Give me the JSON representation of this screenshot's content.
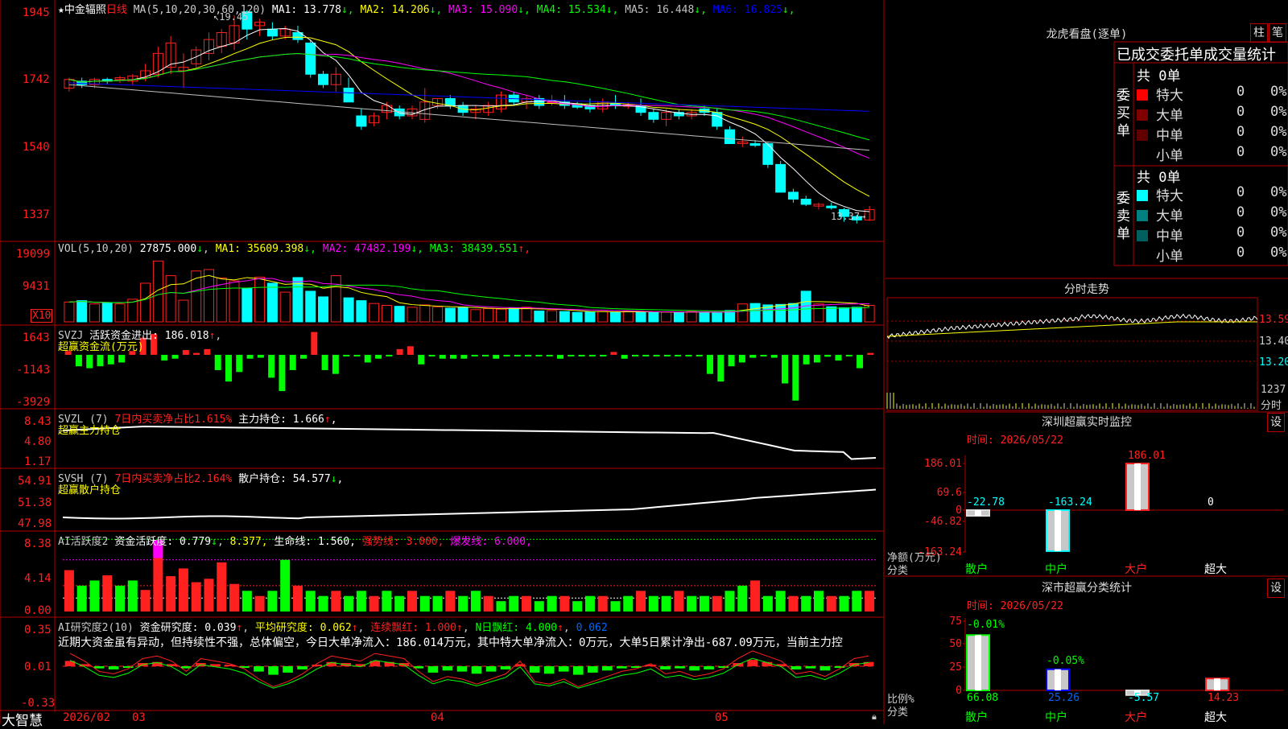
{
  "app": {
    "name": "大智慧"
  },
  "stock": {
    "star": "★",
    "name": "中金辐照",
    "period": "日线"
  },
  "colors": {
    "up": "#ff2020",
    "down": "#00ffff",
    "ma1": "#ffffff",
    "ma2": "#ffff00",
    "ma3": "#ff00ff",
    "ma4": "#00ff00",
    "ma5": "#c0c0c0",
    "ma6": "#0000ff",
    "border": "#b00000",
    "gain": "#00ff00",
    "loss": "#ff2020"
  },
  "kline": {
    "ma_label": "MA(5,10,20,30,60,120)",
    "items": [
      {
        "k": "MA1:",
        "v": "13.778",
        "arrow": "↓",
        "color": "#ffffff"
      },
      {
        "k": "MA2:",
        "v": "14.206",
        "arrow": "↓",
        "color": "#ffff00"
      },
      {
        "k": "MA3:",
        "v": "15.090",
        "arrow": "↓",
        "color": "#ff00ff"
      },
      {
        "k": "MA4:",
        "v": "15.534",
        "arrow": "↓",
        "color": "#00ff00"
      },
      {
        "k": "MA5:",
        "v": "16.448",
        "arrow": "↓",
        "color": "#c0c0c0"
      },
      {
        "k": "MA6:",
        "v": "16.825",
        "arrow": "↓",
        "color": "#0000ff"
      }
    ],
    "y_labels": [
      "1945",
      "1742",
      "1540",
      "1337"
    ],
    "high_mark": "19.45",
    "low_mark": "13.37",
    "ylim": [
      13.2,
      19.6
    ],
    "candles": [
      [
        17.2,
        17.5,
        17.1,
        17.45
      ],
      [
        17.4,
        17.5,
        17.2,
        17.3
      ],
      [
        17.3,
        17.5,
        17.2,
        17.45
      ],
      [
        17.45,
        17.5,
        17.3,
        17.4
      ],
      [
        17.45,
        17.55,
        17.35,
        17.5
      ],
      [
        17.4,
        17.6,
        17.3,
        17.55
      ],
      [
        17.5,
        17.9,
        17.4,
        17.7
      ],
      [
        17.6,
        18.4,
        17.5,
        18.2
      ],
      [
        17.8,
        18.7,
        17.6,
        18.5
      ],
      [
        17.7,
        18.2,
        17.2,
        17.8
      ],
      [
        17.9,
        18.4,
        17.8,
        18.3
      ],
      [
        18.2,
        18.8,
        18.0,
        18.6
      ],
      [
        18.4,
        18.9,
        18.2,
        18.8
      ],
      [
        18.5,
        19.3,
        18.3,
        19.0
      ],
      [
        19.4,
        19.45,
        18.6,
        18.9
      ],
      [
        19.0,
        19.2,
        18.7,
        19.1
      ],
      [
        18.9,
        19.1,
        18.6,
        18.7
      ],
      [
        18.7,
        19.0,
        18.6,
        18.9
      ],
      [
        18.8,
        19.0,
        18.5,
        18.6
      ],
      [
        18.5,
        18.6,
        17.5,
        17.6
      ],
      [
        17.6,
        17.7,
        17.2,
        17.3
      ],
      [
        17.3,
        17.8,
        17.1,
        17.6
      ],
      [
        17.2,
        17.5,
        16.8,
        16.8
      ],
      [
        16.4,
        16.6,
        16.0,
        16.1
      ],
      [
        16.2,
        16.5,
        16.1,
        16.4
      ],
      [
        16.5,
        16.8,
        16.3,
        16.7
      ],
      [
        16.6,
        16.7,
        16.3,
        16.4
      ],
      [
        16.4,
        16.7,
        16.3,
        16.6
      ],
      [
        16.3,
        17.2,
        16.2,
        16.8
      ],
      [
        16.7,
        16.9,
        16.6,
        16.9
      ],
      [
        16.9,
        17.0,
        16.6,
        16.7
      ],
      [
        16.7,
        16.8,
        16.4,
        16.5
      ],
      [
        16.5,
        16.7,
        16.3,
        16.6
      ],
      [
        16.5,
        16.8,
        16.4,
        16.7
      ],
      [
        16.6,
        17.1,
        16.5,
        17.0
      ],
      [
        17.0,
        17.1,
        16.7,
        16.8
      ],
      [
        16.8,
        17.0,
        16.6,
        16.9
      ],
      [
        16.9,
        17.0,
        16.6,
        16.7
      ],
      [
        16.8,
        17.0,
        16.7,
        16.8
      ],
      [
        16.8,
        17.0,
        16.6,
        16.7
      ],
      [
        16.75,
        16.8,
        16.6,
        16.65
      ],
      [
        16.7,
        16.9,
        16.5,
        16.6
      ],
      [
        16.6,
        16.9,
        16.5,
        16.8
      ],
      [
        16.75,
        17.0,
        16.6,
        16.7
      ],
      [
        16.7,
        16.8,
        16.6,
        16.7
      ],
      [
        16.7,
        16.9,
        16.4,
        16.5
      ],
      [
        16.5,
        16.6,
        16.2,
        16.3
      ],
      [
        16.3,
        16.6,
        16.1,
        16.5
      ],
      [
        16.5,
        16.6,
        16.3,
        16.4
      ],
      [
        16.4,
        16.6,
        16.3,
        16.5
      ],
      [
        16.6,
        16.7,
        16.4,
        16.5
      ],
      [
        16.5,
        16.6,
        16.0,
        16.1
      ],
      [
        16.0,
        16.1,
        15.6,
        15.6
      ],
      [
        15.6,
        15.8,
        15.5,
        15.65
      ],
      [
        15.6,
        15.7,
        15.5,
        15.55
      ],
      [
        15.6,
        15.65,
        14.9,
        15.0
      ],
      [
        15.0,
        15.1,
        14.2,
        14.2
      ],
      [
        14.2,
        14.3,
        13.9,
        14.0
      ],
      [
        14.0,
        14.1,
        13.8,
        13.85
      ],
      [
        13.8,
        13.9,
        13.7,
        13.85
      ],
      [
        13.8,
        13.9,
        13.7,
        13.75
      ],
      [
        13.7,
        13.75,
        13.35,
        13.5
      ],
      [
        13.5,
        13.55,
        13.3,
        13.4
      ],
      [
        13.4,
        13.8,
        13.37,
        13.7
      ]
    ]
  },
  "vol": {
    "label": "VOL(5,10,20)",
    "value": "27875.000",
    "value_arrow": "↓",
    "items": [
      {
        "k": "MA1:",
        "v": "35609.398",
        "arrow": "↓",
        "color": "#ffff00"
      },
      {
        "k": "MA2:",
        "v": "47482.199",
        "arrow": "↓",
        "color": "#ff00ff"
      },
      {
        "k": "MA3:",
        "v": "38439.551",
        "arrow": "↑",
        "color": "#00ff00"
      }
    ],
    "y_labels": [
      "19099",
      "9431"
    ],
    "unit": "X10",
    "values": [
      4.2,
      4.5,
      3.8,
      4.0,
      3.8,
      4.8,
      8.2,
      12.9,
      9.8,
      4.6,
      10.8,
      11.1,
      9.3,
      8.7,
      7.1,
      9.5,
      8.2,
      6.3,
      9.4,
      6.5,
      5.3,
      9.8,
      5.1,
      4.5,
      3.9,
      3.5,
      3.3,
      3.1,
      3.6,
      3.2,
      2.9,
      3.0,
      2.6,
      2.8,
      2.7,
      2.9,
      3.1,
      2.3,
      2.4,
      2.2,
      2.0,
      2.1,
      2.2,
      2.1,
      2.3,
      2.0,
      2.0,
      2.1,
      2.0,
      2.2,
      2.0,
      1.9,
      2.4,
      3.8,
      3.9,
      3.6,
      3.7,
      3.9,
      6.5,
      3.8,
      3.2,
      3.0,
      3.1,
      3.5
    ]
  },
  "svzj": {
    "label": "SVZJ",
    "desc": "活跃资金进出:",
    "value": "186.018",
    "arrow": "↑",
    "sub": "超赢资金流(万元)",
    "y_labels": [
      "1643",
      "-1143",
      "-3929"
    ],
    "values": [
      200,
      -600,
      -700,
      -600,
      -500,
      -400,
      200,
      900,
      1100,
      -300,
      -200,
      250,
      100,
      300,
      -800,
      -1400,
      -900,
      -200,
      -150,
      -1200,
      -1900,
      -800,
      -200,
      1200,
      -800,
      -1000,
      -50,
      -50,
      -400,
      -200,
      -50,
      300,
      450,
      -500,
      -50,
      -200,
      -200,
      -200,
      -50,
      -50,
      -200,
      -50,
      -50,
      -50,
      -50,
      -50,
      -200,
      -50,
      -50,
      -50,
      -50,
      150,
      -200,
      -50,
      -50,
      -50,
      -50,
      -50,
      -50,
      -50,
      -1000,
      -1400,
      -600,
      -400,
      -150,
      -50,
      -150,
      -1500,
      -2400,
      -500,
      -400,
      -100,
      -300,
      -50,
      -700,
      100
    ]
  },
  "svzl": {
    "label": "SVZL",
    "param": "(7)",
    "desc": "7日内买卖净占比1.615%",
    "main": "主力持仓:",
    "value": "1.666",
    "arrow": "↑",
    "tail": ",",
    "sub": "超赢主力持仓",
    "y_labels": [
      "8.43",
      "4.80",
      "1.17"
    ]
  },
  "svsh": {
    "label": "SVSH",
    "param": "(7)",
    "desc": "7日内买卖净占比2.164%",
    "main": "散户持仓:",
    "value": "54.577",
    "arrow": "↓",
    "tail": ",",
    "sub": "超赢散户持仓",
    "y_labels": [
      "54.91",
      "51.38",
      "47.98"
    ]
  },
  "ai_active": {
    "label": "AI活跃度2",
    "desc": "资金活跃度:",
    "value": "0.779",
    "arrow": "↓",
    "extra1": "8.377,",
    "life": "生命线:",
    "life_value": "1.560,",
    "strong": "强势线:",
    "strong_value": "3.000,",
    "burst": "爆发线:",
    "burst_value": "6.000,",
    "y_labels": [
      "8.38",
      "4.14",
      "0.00"
    ],
    "values": [
      0.8,
      0.5,
      0.6,
      0.7,
      0.5,
      0.6,
      2.1,
      2.3,
      2.6,
      3.2,
      2.1,
      0.9,
      0.6,
      0.5,
      0.4,
      0.3,
      0.4,
      1.0,
      0.5,
      0.4,
      0.3,
      0.4,
      0.3,
      0.4,
      0.3,
      0.4,
      0.3,
      0.4,
      0.3,
      0.3,
      0.4,
      0.3,
      0.4,
      0.3,
      0.2,
      0.3,
      0.3,
      0.2,
      0.3,
      0.3,
      0.2,
      0.3,
      0.3,
      0.2,
      0.3,
      0.4,
      0.3,
      0.3,
      0.4,
      0.3,
      0.3,
      0.3,
      0.4,
      0.5,
      0.6,
      0.3,
      0.4,
      0.3,
      0.3,
      0.4,
      0.3,
      0.3,
      0.4,
      0.4
    ]
  },
  "ai_research": {
    "label": "AI研究度2(10)",
    "desc": "资金研究度:",
    "value": "0.039",
    "arrow": "↑",
    "avg": "平均研究度:",
    "avg_value": "0.062",
    "avg_arrow": "↑",
    "red": "连续飘红:",
    "red_value": "1.000",
    "red_arrow": "↑",
    "nred": "N日飘红:",
    "nred_value": "4.000",
    "nred_arrow": "↑",
    "tail": "0.062",
    "comment": "近期大资金虽有异动，但持续性不强，总体偏空，今日大单净流入：186.014万元，其中特大单净流入：0万元，大单5日累计净出-687.09万元，当前主力控",
    "y_labels": [
      "0.35",
      "0.01",
      "-0.33"
    ],
    "values": [
      0.05,
      0.02,
      -0.02,
      -0.03,
      -0.01,
      0.03,
      0.04,
      0.02,
      -0.02,
      0.03,
      0.02,
      0.01,
      -0.01,
      -0.05,
      -0.08,
      -0.06,
      -0.03,
      0.01,
      0.04,
      0.03,
      0.02,
      0.05,
      0.04,
      0.03,
      -0.02,
      -0.06,
      -0.04,
      -0.05,
      -0.07,
      -0.05,
      -0.03,
      0.02,
      -0.06,
      -0.07,
      -0.05,
      -0.08,
      -0.06,
      -0.04,
      -0.02,
      -0.01,
      0.01,
      -0.03,
      -0.02,
      -0.04,
      -0.03,
      -0.01,
      0.03,
      0.06,
      0.04,
      0.02,
      -0.03,
      -0.02,
      -0.04,
      -0.01,
      0.03,
      0.04
    ]
  },
  "x_axis": {
    "labels": [
      "2026/02",
      "03",
      "04",
      "05"
    ]
  },
  "dragon": {
    "title": "龙虎看盘(逐单)",
    "tabs": [
      "柱",
      "笔"
    ],
    "subtitle": "已成交委托单成交量统计",
    "buy": {
      "label": "委买单",
      "total": "共 0单",
      "rows": [
        {
          "name": "特大",
          "value": "0",
          "pct": "0%",
          "color": "#ff0000"
        },
        {
          "name": "大单",
          "value": "0",
          "pct": "0%",
          "color": "#800000"
        },
        {
          "name": "中单",
          "value": "0",
          "pct": "0%",
          "color": "#600000"
        },
        {
          "name": "小单",
          "value": "0",
          "pct": "0%",
          "color": ""
        }
      ]
    },
    "sell": {
      "label": "委卖单",
      "total": "共 0单",
      "rows": [
        {
          "name": "特大",
          "value": "0",
          "pct": "0%",
          "color": "#00ffff"
        },
        {
          "name": "大单",
          "value": "0",
          "pct": "0%",
          "color": "#008080"
        },
        {
          "name": "中单",
          "value": "0",
          "pct": "0%",
          "color": "#006060"
        },
        {
          "name": "小单",
          "value": "0",
          "pct": "0%",
          "color": ""
        }
      ]
    }
  },
  "intraday": {
    "title": "分时走势",
    "y_labels": [
      "13.59",
      "13.40",
      "13.20"
    ],
    "vol_label": "1237",
    "sub": "分时"
  },
  "sz_monitor": {
    "title": "深圳超赢实时监控",
    "setting": "设",
    "date": "时间: 2026/05/22",
    "y_labels": [
      "186.01",
      "69.6",
      "0",
      "-46.82",
      "-163.24"
    ],
    "unit": "净额(万元)",
    "class_label": "分类",
    "categories": [
      "散户",
      "中户",
      "大户",
      "超大"
    ],
    "values": [
      -22.78,
      -163.24,
      186.01,
      0
    ],
    "value_labels": [
      "-22.78",
      "-163.24",
      "186.01",
      "0"
    ]
  },
  "sz_class": {
    "title": "深市超赢分类统计",
    "setting": "设",
    "date": "时间: 2026/05/22",
    "y_labels": [
      "75",
      "50",
      "25",
      "0"
    ],
    "unit": "比例%",
    "class_label": "分类",
    "categories": [
      "散户",
      "中户",
      "大户",
      "超大"
    ],
    "values": [
      66.08,
      25.26,
      -5.57,
      14.23
    ],
    "value_labels": [
      "66.08",
      "25.26",
      "-5.57",
      "14.23"
    ],
    "top_labels": [
      "-0.01%",
      "-0.05%"
    ]
  }
}
